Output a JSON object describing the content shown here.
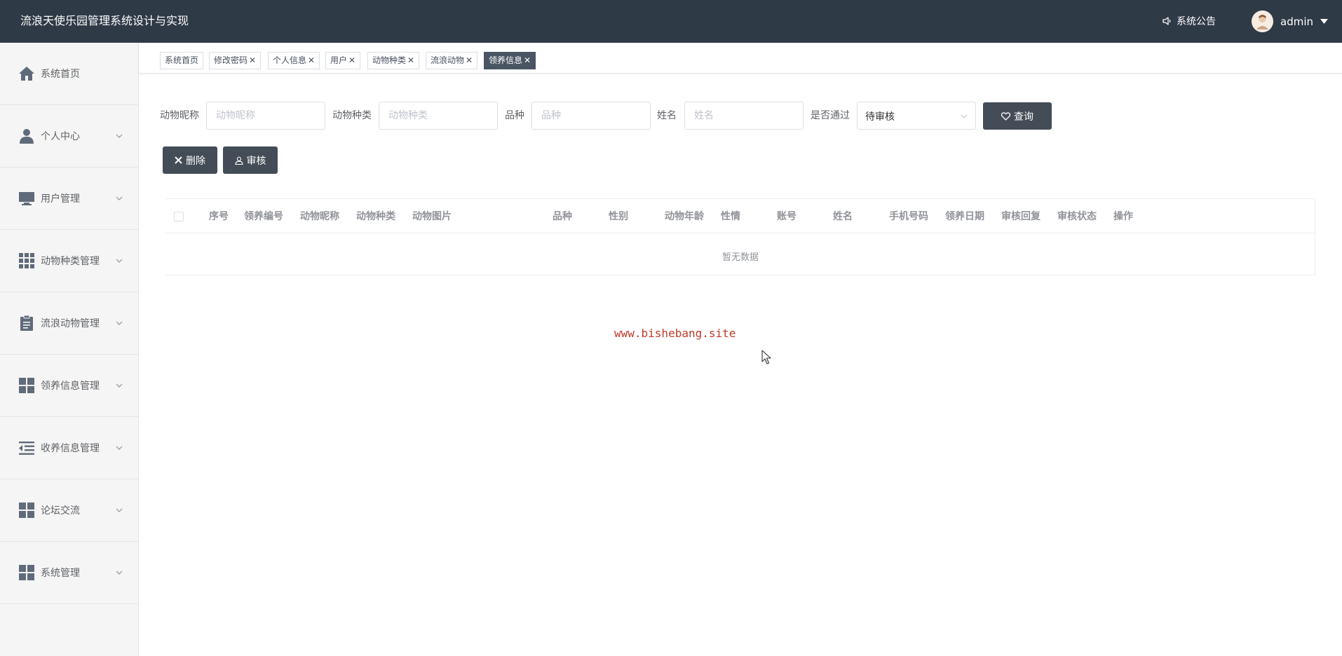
{
  "app": {
    "title": "流浪天使乐园管理系统设计与实现"
  },
  "header": {
    "notice_label": "系统公告",
    "username": "admin"
  },
  "sidebar": {
    "items": [
      {
        "label": "系统首页",
        "icon": "home-icon",
        "expandable": false
      },
      {
        "label": "个人中心",
        "icon": "user-icon",
        "expandable": true
      },
      {
        "label": "用户管理",
        "icon": "monitor-icon",
        "expandable": true
      },
      {
        "label": "动物种类管理",
        "icon": "grid-icon",
        "expandable": true
      },
      {
        "label": "流浪动物管理",
        "icon": "clipboard-icon",
        "expandable": true
      },
      {
        "label": "领养信息管理",
        "icon": "tiles-icon",
        "expandable": true
      },
      {
        "label": "收养信息管理",
        "icon": "outdent-icon",
        "expandable": true
      },
      {
        "label": "论坛交流",
        "icon": "tiles-icon",
        "expandable": true
      },
      {
        "label": "系统管理",
        "icon": "tiles-icon",
        "expandable": true
      }
    ]
  },
  "tabs": [
    {
      "label": "系统首页",
      "closable": false,
      "active": false
    },
    {
      "label": "修改密码",
      "closable": true,
      "active": false
    },
    {
      "label": "个人信息",
      "closable": true,
      "active": false
    },
    {
      "label": "用户",
      "closable": true,
      "active": false
    },
    {
      "label": "动物种类",
      "closable": true,
      "active": false
    },
    {
      "label": "流浪动物",
      "closable": true,
      "active": false
    },
    {
      "label": "领养信息",
      "closable": true,
      "active": true
    }
  ],
  "filters": {
    "nickname": {
      "label": "动物昵称",
      "placeholder": "动物昵称",
      "value": ""
    },
    "category": {
      "label": "动物种类",
      "placeholder": "动物种类",
      "value": ""
    },
    "breed": {
      "label": "品种",
      "placeholder": "品种",
      "value": ""
    },
    "name": {
      "label": "姓名",
      "placeholder": "姓名",
      "value": ""
    },
    "approved": {
      "label": "是否通过",
      "value": "待审核"
    },
    "search_label": "查询"
  },
  "actions": {
    "delete_label": "删除",
    "review_label": "审核"
  },
  "table": {
    "columns": [
      "序号",
      "领养编号",
      "动物昵称",
      "动物种类",
      "动物图片",
      "品种",
      "性别",
      "动物年龄",
      "性情",
      "账号",
      "姓名",
      "手机号码",
      "领养日期",
      "审核回复",
      "审核状态",
      "操作"
    ],
    "rows": [],
    "empty_text": "暂无数据"
  },
  "watermark": "www.bishebang.site",
  "colors": {
    "topbar": "#2f3a47",
    "button": "#434c57",
    "active_tab": "#4a5563",
    "watermark": "#c0392b"
  }
}
